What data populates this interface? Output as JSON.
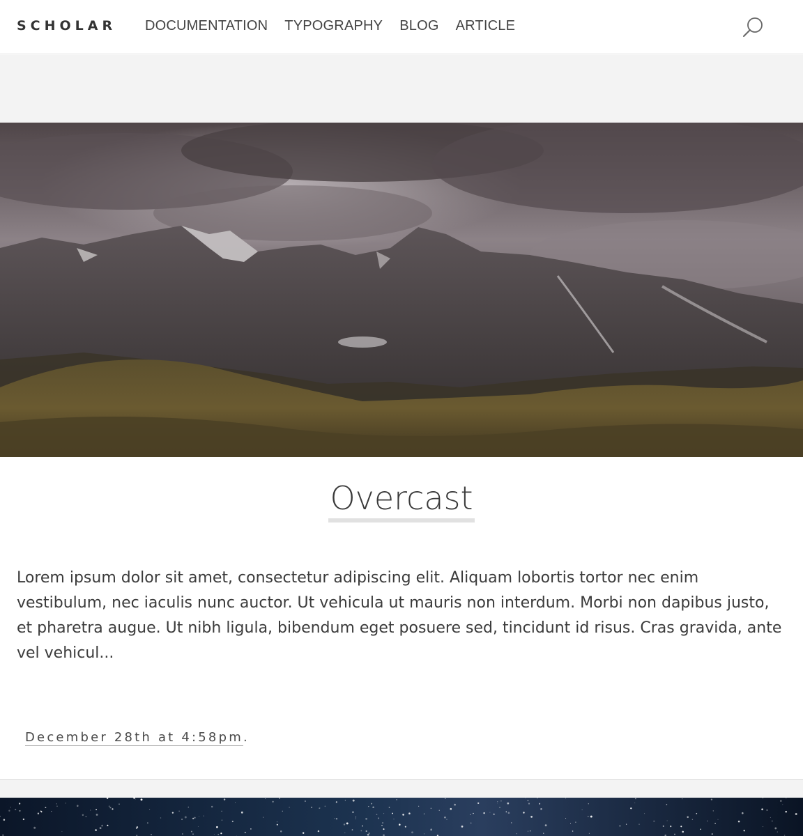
{
  "site": {
    "brand": "SCHOLAR"
  },
  "nav": {
    "items": [
      {
        "label": "DOCUMENTATION"
      },
      {
        "label": "TYPOGRAPHY"
      },
      {
        "label": "BLOG"
      },
      {
        "label": "ARTICLE"
      }
    ]
  },
  "icons": {
    "search": "search-icon"
  },
  "post": {
    "title": "Overcast",
    "excerpt": "Lorem ipsum dolor sit amet, consectetur adipiscing elit. Aliquam lobortis tortor nec enim vestibulum, nec iaculis nunc auctor. Ut vehicula ut mauris non interdum. Morbi non dapibus justo, et pharetra augue. Ut nibh ligula, bibendum eget posuere sed, tincidunt id risus. Cras gravida, ante vel vehicul...",
    "date": "December 28th at 4:58pm",
    "date_suffix": "."
  },
  "colors": {
    "page_background": "#ffffff",
    "band_background": "#f3f3f3",
    "text": "#333333",
    "title_underline": "#e1e1e1"
  }
}
